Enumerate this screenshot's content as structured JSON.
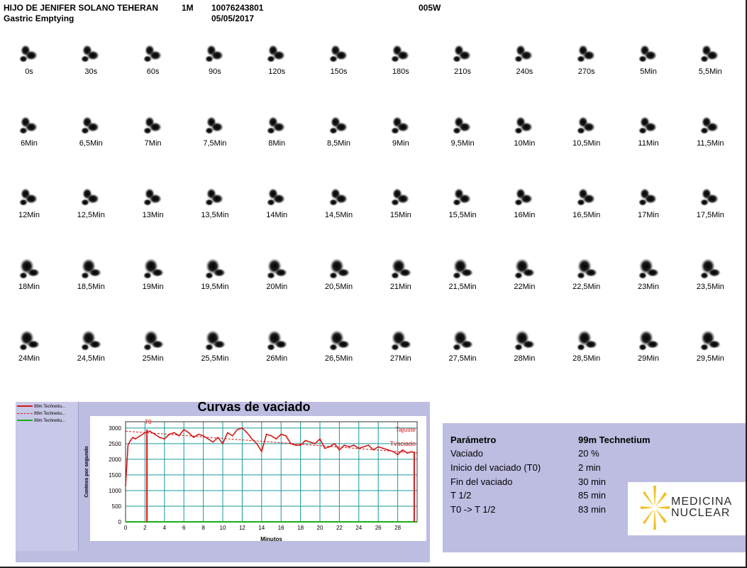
{
  "header": {
    "patient": "HIJO DE JENIFER SOLANO TEHERAN",
    "sex_age": "1M",
    "id_number": "10076243801",
    "code": "005W",
    "study": "Gastric Emptying",
    "date": "05/05/2017"
  },
  "frames": [
    "0s",
    "30s",
    "60s",
    "90s",
    "120s",
    "150s",
    "180s",
    "210s",
    "240s",
    "270s",
    "5Min",
    "5,5Min",
    "6Min",
    "6,5Min",
    "7Min",
    "7,5Min",
    "8Min",
    "8,5Min",
    "9Min",
    "9,5Min",
    "10Min",
    "10,5Min",
    "11Min",
    "11,5Min",
    "12Min",
    "12,5Min",
    "13Min",
    "13,5Min",
    "14Min",
    "14,5Min",
    "15Min",
    "15,5Min",
    "16Min",
    "16,5Min",
    "17Min",
    "17,5Min",
    "18Min",
    "18,5Min",
    "19Min",
    "19,5Min",
    "20Min",
    "20,5Min",
    "21Min",
    "21,5Min",
    "22Min",
    "22,5Min",
    "23Min",
    "23,5Min",
    "24Min",
    "24,5Min",
    "25Min",
    "25,5Min",
    "26Min",
    "26,5Min",
    "27Min",
    "27,5Min",
    "28Min",
    "28,5Min",
    "29Min",
    "29,5Min"
  ],
  "chart_data": {
    "type": "line",
    "title": "Curvas de vaciado",
    "xlabel": "Minutos",
    "ylabel": "Conteos por segundo",
    "xlim": [
      0,
      30
    ],
    "ylim": [
      0,
      3200
    ],
    "xticks": [
      "0",
      "2",
      "4",
      "6",
      "8",
      "10",
      "12",
      "14",
      "16",
      "18",
      "20",
      "22",
      "24",
      "26",
      "28"
    ],
    "yticks": [
      "0",
      "500",
      "1000",
      "1500",
      "2000",
      "2500",
      "3000"
    ],
    "grid": true,
    "legend_placement": "top-left",
    "legend": [
      "99m Technetiu...",
      "99m Technetiu...",
      "99m Technetiu..."
    ],
    "colors": {
      "main": "#d41818",
      "fit": "#d41818",
      "baseline": "#18b018",
      "grid": "#1a9a9a"
    },
    "annotations": {
      "t0": "T0",
      "tajuste": "Tajuste",
      "tvaciado": "Tvaciado"
    },
    "series": [
      {
        "name": "99m Technetiu...",
        "style": "solid",
        "x": [
          0,
          0.25,
          0.5,
          0.75,
          1,
          1.5,
          2,
          2.5,
          3,
          3.5,
          4,
          4.5,
          5,
          5.5,
          6,
          6.5,
          7,
          7.5,
          8,
          8.5,
          9,
          9.5,
          10,
          10.5,
          11,
          11.5,
          12,
          12.5,
          13,
          13.5,
          14,
          14.5,
          15,
          15.5,
          16,
          16.5,
          17,
          17.5,
          18,
          18.5,
          19,
          19.5,
          20,
          20.5,
          21,
          21.5,
          22,
          22.5,
          23,
          23.5,
          24,
          24.5,
          25,
          25.5,
          26,
          26.5,
          27,
          27.5,
          28,
          28.5,
          29,
          29.5
        ],
        "values": [
          1150,
          2450,
          2600,
          2700,
          2650,
          2750,
          2850,
          2900,
          2800,
          2700,
          2650,
          2800,
          2850,
          2750,
          2950,
          2850,
          2700,
          2800,
          2750,
          2650,
          2550,
          2700,
          2500,
          2850,
          2750,
          2950,
          3000,
          2850,
          2650,
          2500,
          2250,
          2800,
          2750,
          2650,
          2800,
          2750,
          2500,
          2450,
          2450,
          2600,
          2550,
          2500,
          2650,
          2350,
          2400,
          2500,
          2300,
          2450,
          2400,
          2450,
          2350,
          2400,
          2450,
          2300,
          2400,
          2350,
          2300,
          2250,
          2150,
          2300,
          2200,
          2250
        ]
      },
      {
        "name": "99m Technetiu...",
        "style": "dashed",
        "x": [
          0,
          30
        ],
        "values": [
          2900,
          2200
        ]
      },
      {
        "name": "99m Technetiu...",
        "style": "solid",
        "x": [
          0,
          30
        ],
        "values": [
          0,
          0
        ]
      }
    ]
  },
  "params": {
    "head_label": "Parámetro",
    "head_value": "99m Technetium",
    "rows": [
      {
        "label": "Vaciado",
        "value": "20 %"
      },
      {
        "label": "Inicio del vaciado (T0)",
        "value": "2 min"
      },
      {
        "label": "Fin del vaciado",
        "value": "30 min"
      },
      {
        "label": "T 1/2",
        "value": "85 min"
      },
      {
        "label": "T0 -> T 1/2",
        "value": "83 min"
      }
    ]
  },
  "logo": {
    "line1": "MEDICINA",
    "line2": "NUCLEAR",
    "color": "#f0c020"
  }
}
